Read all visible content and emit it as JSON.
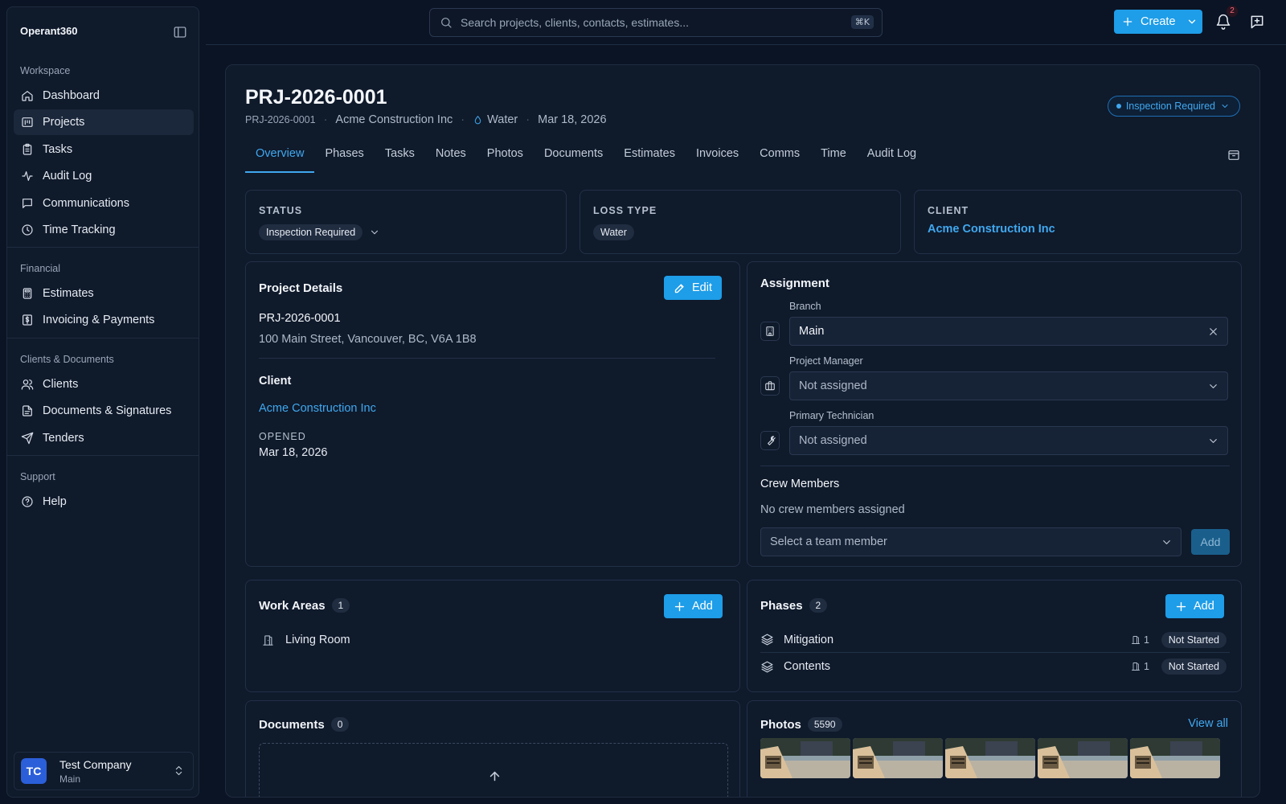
{
  "app": {
    "name": "Operant360"
  },
  "sidebar": {
    "sections": [
      {
        "title": "Workspace",
        "items": [
          {
            "label": "Dashboard",
            "icon": "home-icon"
          },
          {
            "label": "Projects",
            "icon": "projects-icon",
            "active": true
          },
          {
            "label": "Tasks",
            "icon": "clipboard-icon"
          },
          {
            "label": "Audit Log",
            "icon": "activity-icon"
          },
          {
            "label": "Communications",
            "icon": "message-icon"
          },
          {
            "label": "Time Tracking",
            "icon": "clock-icon"
          }
        ]
      },
      {
        "title": "Financial",
        "items": [
          {
            "label": "Estimates",
            "icon": "calculator-icon"
          },
          {
            "label": "Invoicing & Payments",
            "icon": "dollar-icon"
          }
        ]
      },
      {
        "title": "Clients & Documents",
        "items": [
          {
            "label": "Clients",
            "icon": "users-icon"
          },
          {
            "label": "Documents & Signatures",
            "icon": "file-icon"
          },
          {
            "label": "Tenders",
            "icon": "send-icon"
          }
        ]
      },
      {
        "title": "Support",
        "items": [
          {
            "label": "Help",
            "icon": "help-icon"
          }
        ]
      }
    ],
    "company": {
      "initials": "TC",
      "name": "Test Company",
      "branch": "Main"
    }
  },
  "topbar": {
    "search_placeholder": "Search projects, clients, contacts, estimates...",
    "shortcut": "⌘K",
    "create_label": "Create",
    "notification_count": "2"
  },
  "project": {
    "title": "PRJ-2026-0001",
    "id": "PRJ-2026-0001",
    "client": "Acme Construction Inc",
    "loss_type": "Water",
    "date": "Mar 18, 2026",
    "status": "Inspection Required"
  },
  "tabs": [
    "Overview",
    "Phases",
    "Tasks",
    "Notes",
    "Photos",
    "Documents",
    "Estimates",
    "Invoices",
    "Comms",
    "Time",
    "Audit Log"
  ],
  "summary": {
    "status_label": "STATUS",
    "status_value": "Inspection Required",
    "loss_label": "LOSS TYPE",
    "loss_value": "Water",
    "client_label": "CLIENT",
    "client_value": "Acme Construction Inc"
  },
  "details": {
    "title": "Project Details",
    "edit_label": "Edit",
    "number": "PRJ-2026-0001",
    "address": "100 Main Street, Vancouver, BC, V6A 1B8",
    "client_heading": "Client",
    "client_name": "Acme Construction Inc",
    "opened_label": "OPENED",
    "opened_value": "Mar 18, 2026"
  },
  "assignment": {
    "title": "Assignment",
    "branch_label": "Branch",
    "branch_value": "Main",
    "pm_label": "Project Manager",
    "pm_value": "Not assigned",
    "tech_label": "Primary Technician",
    "tech_value": "Not assigned",
    "crew_title": "Crew Members",
    "crew_empty": "No crew members assigned",
    "crew_placeholder": "Select a team member",
    "crew_add": "Add"
  },
  "work_areas": {
    "title": "Work Areas",
    "count": "1",
    "add_label": "Add",
    "items": [
      "Living Room"
    ]
  },
  "phases": {
    "title": "Phases",
    "count": "2",
    "add_label": "Add",
    "items": [
      {
        "name": "Mitigation",
        "count": "1",
        "status": "Not Started"
      },
      {
        "name": "Contents",
        "count": "1",
        "status": "Not Started"
      }
    ]
  },
  "documents": {
    "title": "Documents",
    "count": "0"
  },
  "photos": {
    "title": "Photos",
    "count": "5590",
    "view_all": "View all"
  },
  "colors": {
    "accent": "#1e9de8",
    "link": "#40a8ef",
    "background": "#0b1424",
    "panel": "#0f1a2b"
  }
}
